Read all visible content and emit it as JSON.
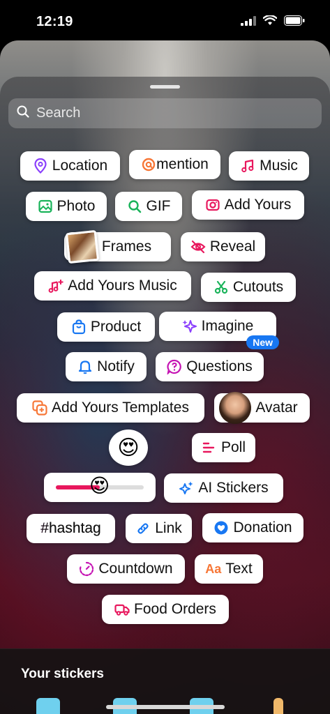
{
  "status_bar": {
    "time": "12:19"
  },
  "search": {
    "placeholder": "Search"
  },
  "stickers": {
    "location": "Location",
    "mention": "mention",
    "music": "Music",
    "photo": "Photo",
    "gif": "GIF",
    "add_yours": "Add Yours",
    "frames": "Frames",
    "reveal": "Reveal",
    "add_yours_music": "Add Yours Music",
    "cutouts": "Cutouts",
    "product": "Product",
    "imagine": "Imagine",
    "imagine_badge": "New",
    "notify": "Notify",
    "questions": "Questions",
    "add_yours_templates": "Add Yours Templates",
    "avatar": "Avatar",
    "poll": "Poll",
    "ai_stickers": "AI Stickers",
    "hashtag": "#hashtag",
    "link": "Link",
    "donation": "Donation",
    "countdown": "Countdown",
    "text": "Text",
    "food_orders": "Food Orders"
  },
  "emoji_slider": {
    "emoji": "😍",
    "level": 0.5
  },
  "emoji_reaction": {
    "emoji": "😍"
  },
  "your_stickers": {
    "title": "Your stickers"
  },
  "colors": {
    "accent_pink": "#e8175d",
    "accent_purple": "#8a3ffc",
    "accent_green": "#19b35a",
    "accent_orange": "#f77737",
    "accent_blue": "#1877f2"
  }
}
